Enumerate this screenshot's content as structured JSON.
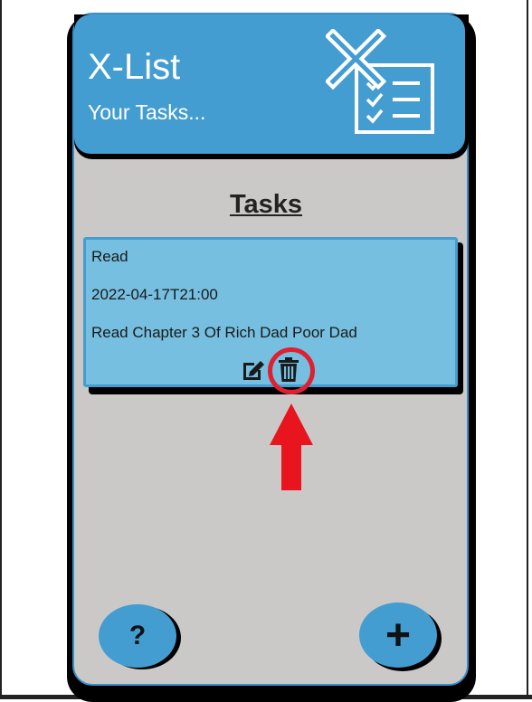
{
  "header": {
    "title": "X-List",
    "subtitle": "Your Tasks...",
    "logo_icon": "checklist-with-x-icon"
  },
  "main": {
    "heading": "Tasks",
    "tasks": [
      {
        "title": "Read",
        "datetime": "2022-04-17T21:00",
        "description": "Read Chapter 3 Of Rich Dad Poor Dad",
        "actions": [
          "edit-icon",
          "trash-icon"
        ]
      }
    ]
  },
  "footer": {
    "help_label": "?",
    "add_label": "+"
  },
  "annotation": {
    "highlight_color": "#e02030",
    "target": "trash-icon"
  },
  "colors": {
    "accent": "#449dd1",
    "card": "#76bfe0",
    "background": "#cbc9c8"
  }
}
